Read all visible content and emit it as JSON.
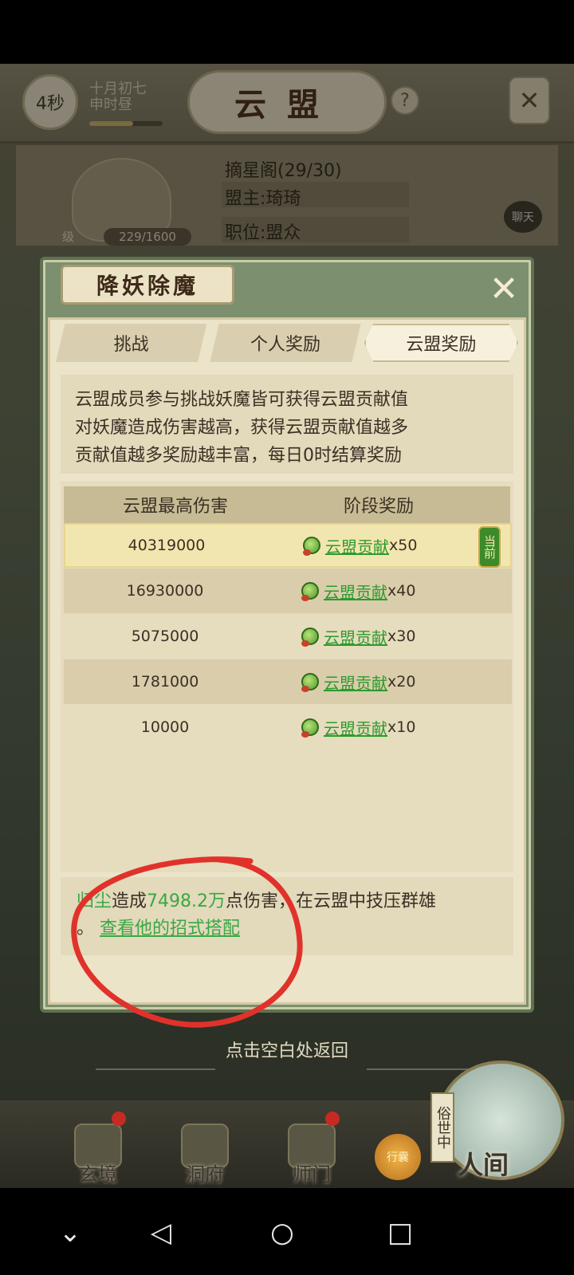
{
  "header": {
    "timer": "4秒",
    "date_line1": "十月初七",
    "date_line2": "申时昼",
    "date_progress": 0.6,
    "title": "云盟",
    "help_icon": "question-icon",
    "tools_icon": "crossed-tools-icon"
  },
  "alliance": {
    "name_line": "摘星阁(29/30)",
    "leader_line": "盟主:琦琦",
    "position_line": "职位:盟众",
    "level_prefix": "级",
    "exp": "229/1600",
    "chat_label": "聊天"
  },
  "modal": {
    "title": "降妖除魔",
    "tabs": [
      {
        "label": "挑战",
        "active": false
      },
      {
        "label": "个人奖励",
        "active": false
      },
      {
        "label": "云盟奖励",
        "active": true
      }
    ],
    "desc_lines": [
      "云盟成员参与挑战妖魔皆可获得云盟贡献值",
      "对妖魔造成伤害越高，获得云盟贡献值越多",
      "贡献值越多奖励越丰富，每日0时结算奖励"
    ],
    "table": {
      "col1": "云盟最高伤害",
      "col2": "阶段奖励",
      "current_tag": "当前",
      "rows": [
        {
          "damage": "40319000",
          "reward": "云盟贡献",
          "qty": "x50"
        },
        {
          "damage": "16930000",
          "reward": "云盟贡献",
          "qty": "x40"
        },
        {
          "damage": "5075000",
          "reward": "云盟贡献",
          "qty": "x30"
        },
        {
          "damage": "1781000",
          "reward": "云盟贡献",
          "qty": "x20"
        },
        {
          "damage": "10000",
          "reward": "云盟贡献",
          "qty": "x10"
        }
      ]
    },
    "note": {
      "player": "归尘",
      "text_a": "造成",
      "damage": "7498.2万",
      "text_b": "点伤害，在云盟中技压群雄",
      "text_c": "。",
      "link": "查看他的招式搭配"
    }
  },
  "back_hint": "点击空白处返回",
  "bottom_nav": [
    {
      "label": "玄境",
      "icon": "scroll-icon",
      "dot": true
    },
    {
      "label": "洞府",
      "icon": "pavilion-icon",
      "dot": false
    },
    {
      "label": "师门",
      "icon": "banner-icon",
      "dot": true
    }
  ],
  "world": {
    "side": "俗世中",
    "label": "人间",
    "shop": "行囊"
  },
  "colors": {
    "accent_green": "#39a844",
    "annotation_red": "#e0322b"
  }
}
